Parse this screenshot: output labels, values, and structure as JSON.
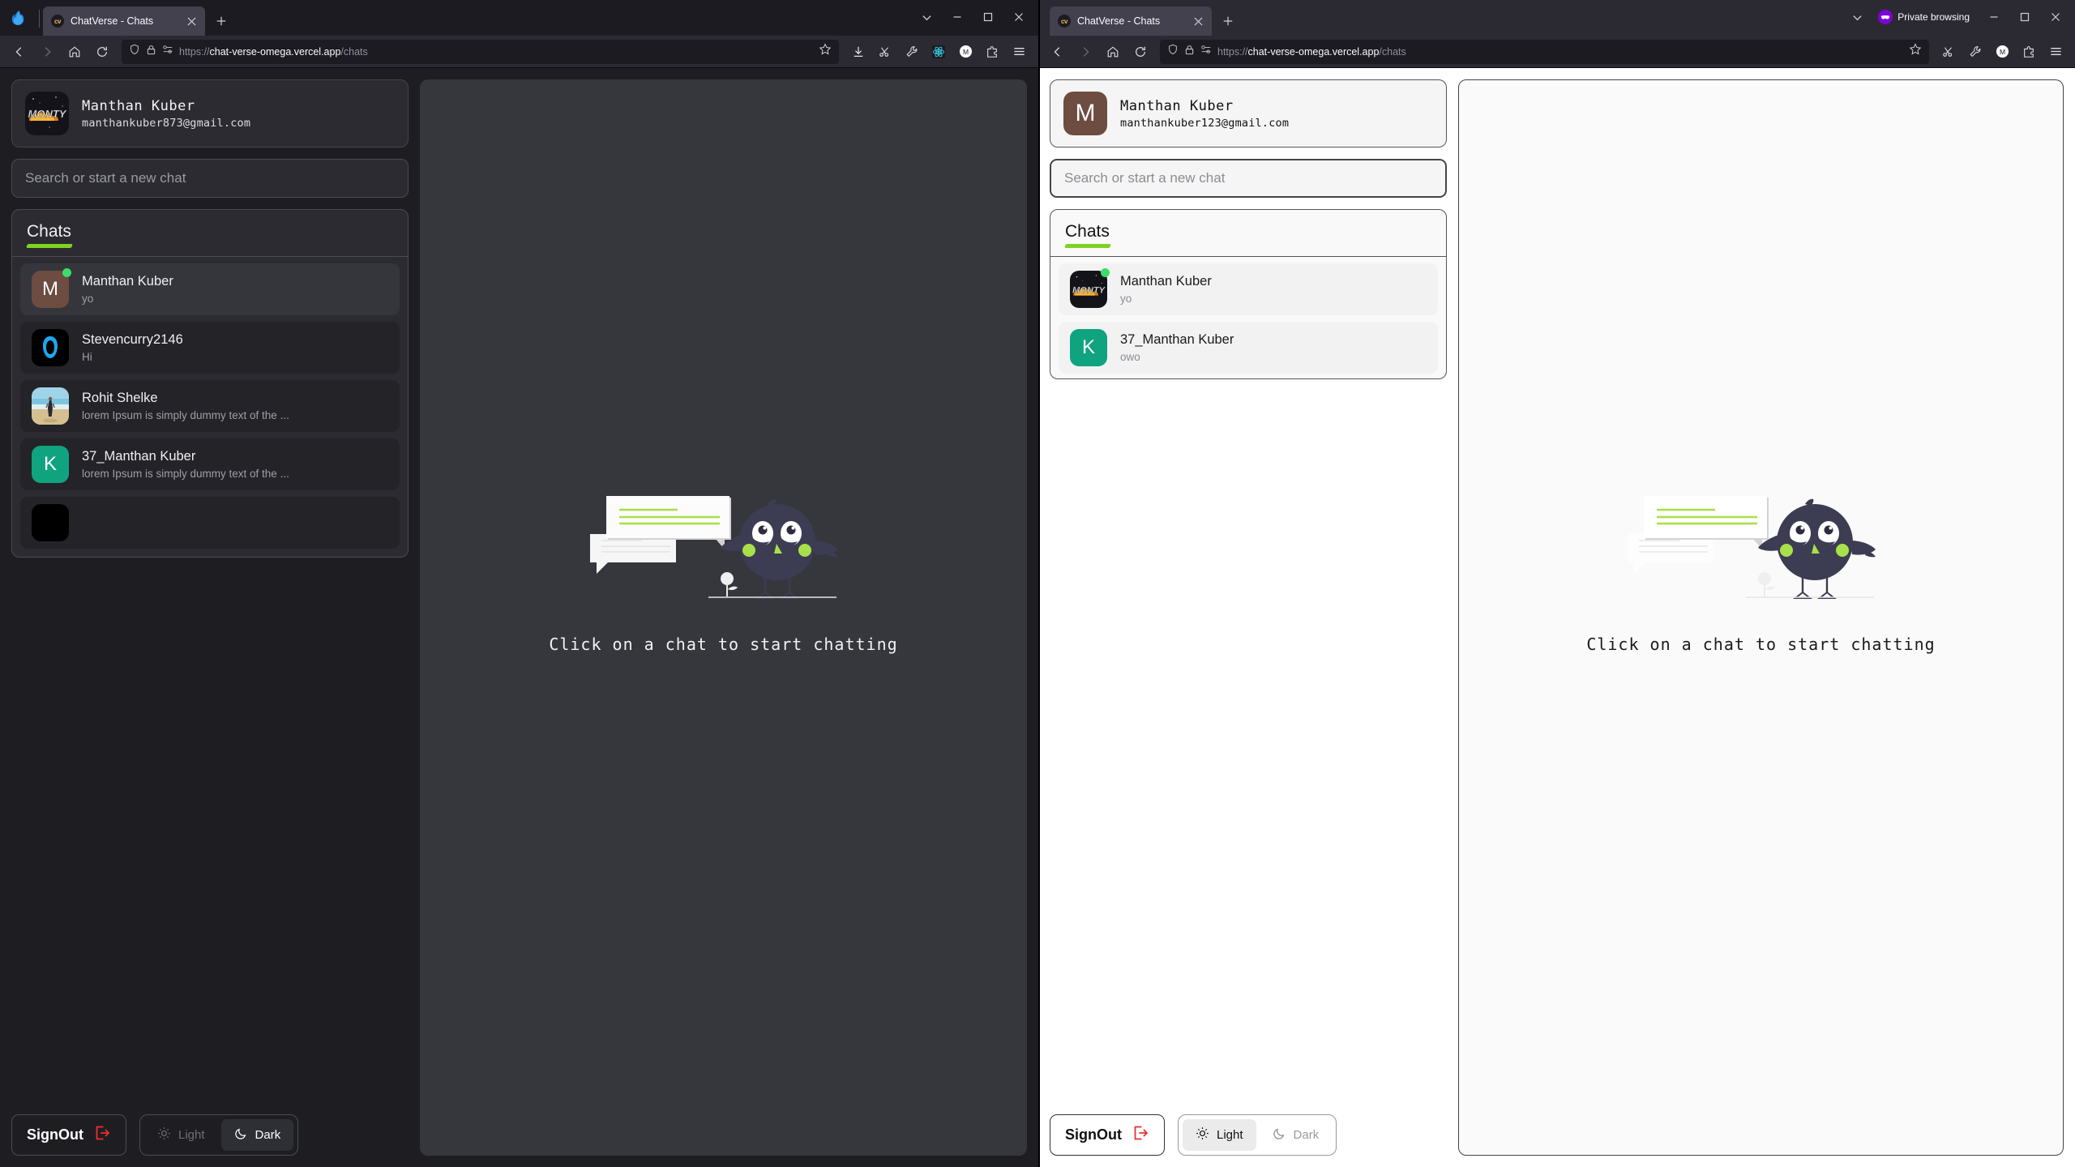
{
  "windows": {
    "left": {
      "tab": {
        "title": "ChatVerse - Chats",
        "favicon_text": "cv"
      },
      "url": {
        "scheme": "https://",
        "host": "chat-verse-omega.vercel.app",
        "path": "/chats"
      },
      "titlebar_buttons": [
        "tab-list-chevron",
        "minimize",
        "maximize",
        "close"
      ],
      "toolbar_icons": [
        "downloads",
        "screenshot",
        "wrench",
        "react-devtools",
        "account-m",
        "extension",
        "app-menu"
      ],
      "theme": "dark",
      "profile": {
        "name": "Manthan Kuber",
        "email": "manthankuber873@gmail.com",
        "avatar_type": "image",
        "avatar_label": "MONTY"
      },
      "search": {
        "placeholder": "Search or start a new chat",
        "value": ""
      },
      "chats_header": "Chats",
      "chats": [
        {
          "name": "Manthan Kuber",
          "message": "yo",
          "avatar_type": "letter",
          "avatar_letter": "M",
          "avatar_color": "#6d4c41",
          "online": true,
          "active": true
        },
        {
          "name": "Stevencurry2146",
          "message": "Hi",
          "avatar_type": "image-dark",
          "avatar_letter": "",
          "avatar_color": "#000000",
          "online": false,
          "active": false
        },
        {
          "name": "Rohit Shelke",
          "message": "lorem Ipsum is simply dummy text of the ...",
          "avatar_type": "photo-beach",
          "avatar_letter": "",
          "avatar_color": "#c8b48c",
          "online": false,
          "active": false
        },
        {
          "name": "37_Manthan Kuber",
          "message": "lorem Ipsum is simply dummy text of the ...",
          "avatar_type": "letter",
          "avatar_letter": "K",
          "avatar_color": "#10a37f",
          "online": false,
          "active": false
        },
        {
          "name": "",
          "message": "",
          "avatar_type": "image-dark",
          "avatar_letter": "",
          "avatar_color": "#000000",
          "online": false,
          "active": false
        }
      ],
      "signout_label": "SignOut",
      "theme_options": [
        {
          "label": "Light",
          "selected": false
        },
        {
          "label": "Dark",
          "selected": true
        }
      ],
      "empty_state_text": "Click on a chat to start chatting"
    },
    "right": {
      "tab": {
        "title": "ChatVerse - Chats",
        "favicon_text": "cv"
      },
      "url": {
        "scheme": "https://",
        "host": "chat-verse-omega.vercel.app",
        "path": "/chats"
      },
      "private_badge": "Private browsing",
      "titlebar_buttons": [
        "tab-list-chevron",
        "minimize",
        "maximize",
        "close"
      ],
      "toolbar_icons": [
        "screenshot",
        "wrench",
        "account-m",
        "extension",
        "app-menu"
      ],
      "theme": "light",
      "profile": {
        "name": "Manthan Kuber",
        "email": "manthankuber123@gmail.com",
        "avatar_type": "letter",
        "avatar_letter": "M",
        "avatar_color": "#6d4c41"
      },
      "search": {
        "placeholder": "Search or start a new chat",
        "value": ""
      },
      "chats_header": "Chats",
      "chats": [
        {
          "name": "Manthan Kuber",
          "message": "yo",
          "avatar_type": "photo-monty",
          "avatar_letter": "",
          "avatar_color": "#111111",
          "online": true,
          "active": false
        },
        {
          "name": "37_Manthan Kuber",
          "message": "owo",
          "avatar_type": "letter",
          "avatar_letter": "K",
          "avatar_color": "#10a37f",
          "online": false,
          "active": false
        }
      ],
      "signout_label": "SignOut",
      "theme_options": [
        {
          "label": "Light",
          "selected": true
        },
        {
          "label": "Dark",
          "selected": false
        }
      ],
      "empty_state_text": "Click on a chat to start chatting"
    }
  },
  "colors": {
    "accent_green": "#7ed321",
    "online_dot": "#3ddc6a",
    "signout_icon": "#f02e2e",
    "bird_body": "#3c3c52",
    "bird_cheek": "#a8e04a",
    "teal_avatar": "#10a37f",
    "brown_avatar": "#6d4c41"
  }
}
